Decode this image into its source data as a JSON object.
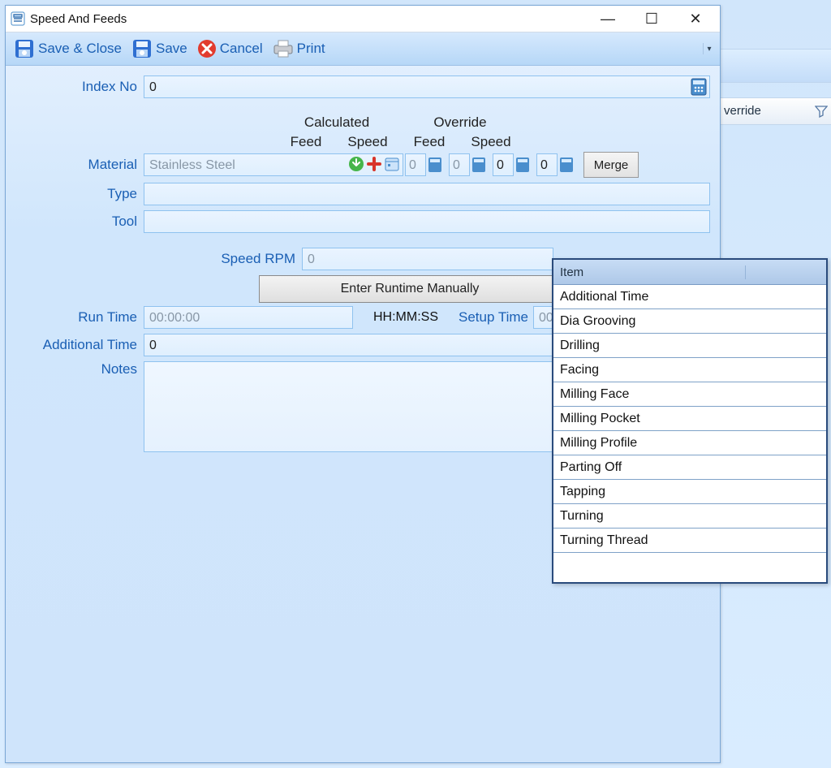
{
  "bg": {
    "header_col": "verride"
  },
  "window": {
    "title": "Speed And Feeds",
    "toolbar": {
      "save_close": "Save & Close",
      "save": "Save",
      "cancel": "Cancel",
      "print": "Print"
    },
    "labels": {
      "index_no": "Index No",
      "material": "Material",
      "type": "Type",
      "tool": "Tool",
      "speed_rpm": "Speed RPM",
      "enter_runtime": "Enter Runtime Manually",
      "run_time": "Run Time",
      "time_hint": "HH:MM:SS",
      "setup_time": "Setup Time",
      "additional_time": "Additional Time",
      "notes": "Notes",
      "calculated": "Calculated",
      "override": "Override",
      "feed": "Feed",
      "speed": "Speed",
      "merge": "Merge"
    },
    "values": {
      "index_no": "0",
      "material": "Stainless Steel",
      "calc_feed": "0",
      "calc_speed": "0",
      "over_feed": "0",
      "over_speed": "0",
      "type": "",
      "tool": "",
      "speed_rpm": "0",
      "run_time": "00:00:00",
      "setup_time": "00:",
      "additional_time": "0",
      "notes": ""
    }
  },
  "dropdown": {
    "header": "Item",
    "items": [
      "Additional Time",
      "Dia Grooving",
      "Drilling",
      "Facing",
      "Milling Face",
      "Milling Pocket",
      "Milling Profile",
      "Parting Off",
      "Tapping",
      "Turning",
      "Turning Thread"
    ]
  }
}
